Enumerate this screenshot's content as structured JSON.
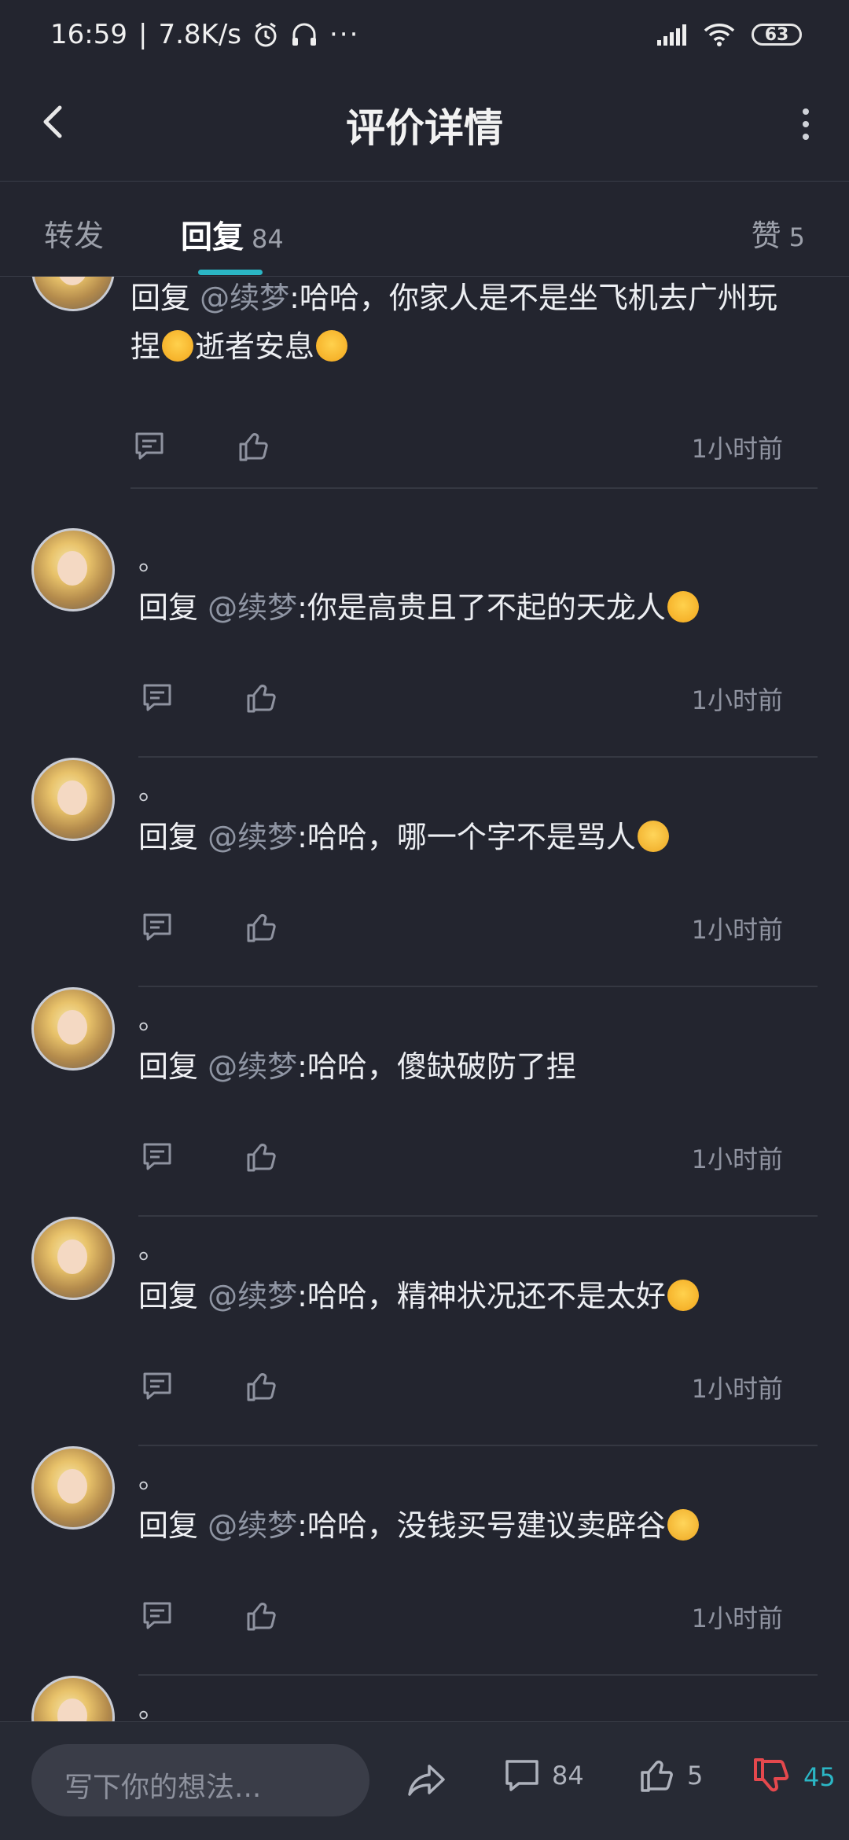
{
  "status": {
    "time": "16:59",
    "speed": "7.8K/s",
    "battery": "63"
  },
  "header": {
    "title": "评价详情"
  },
  "tabs": [
    {
      "label": "转发",
      "count": ""
    },
    {
      "label": "回复",
      "count": "84"
    },
    {
      "label": "赞",
      "count": "5"
    }
  ],
  "comments": [
    {
      "name": "。",
      "prefix": "回复 ",
      "mention": "@续梦",
      "text": ":哈哈，你家人是不是坐飞机去广州玩捏",
      "text2": "逝者安息",
      "emoji": "cry",
      "time": "1小时前"
    },
    {
      "name": "。",
      "prefix": "回复 ",
      "mention": "@续梦",
      "text": ":你是高贵且了不起的天龙人",
      "emoji": "cry",
      "time": "1小时前"
    },
    {
      "name": "。",
      "prefix": "回复 ",
      "mention": "@续梦",
      "text": ":哈哈，哪一个字不是骂人",
      "emoji": "hug",
      "time": "1小时前"
    },
    {
      "name": "。",
      "prefix": "回复 ",
      "mention": "@续梦",
      "text": ":哈哈，傻缺破防了捏",
      "emoji": "",
      "time": "1小时前"
    },
    {
      "name": "。",
      "prefix": "回复 ",
      "mention": "@续梦",
      "text": ":哈哈，精神状况还不是太好",
      "emoji": "cry",
      "time": "1小时前"
    },
    {
      "name": "。",
      "prefix": "回复 ",
      "mention": "@续梦",
      "text": ":哈哈，没钱买号建议卖辟谷",
      "emoji": "hug",
      "time": "1小时前"
    },
    {
      "name": "。"
    }
  ],
  "bottom": {
    "placeholder": "写下你的想法...",
    "comment_count": "84",
    "like_count": "5",
    "dislike_count": "45",
    "dislike_color": "#e5484d",
    "dislike_count_color": "#2bb6c5"
  },
  "icons": [
    "back-arrow-icon",
    "more-vertical-icon",
    "comment-icon",
    "thumbs-up-icon",
    "share-icon",
    "thumbs-down-icon",
    "signal-icon",
    "wifi-icon",
    "alarm-icon",
    "headphones-icon"
  ]
}
